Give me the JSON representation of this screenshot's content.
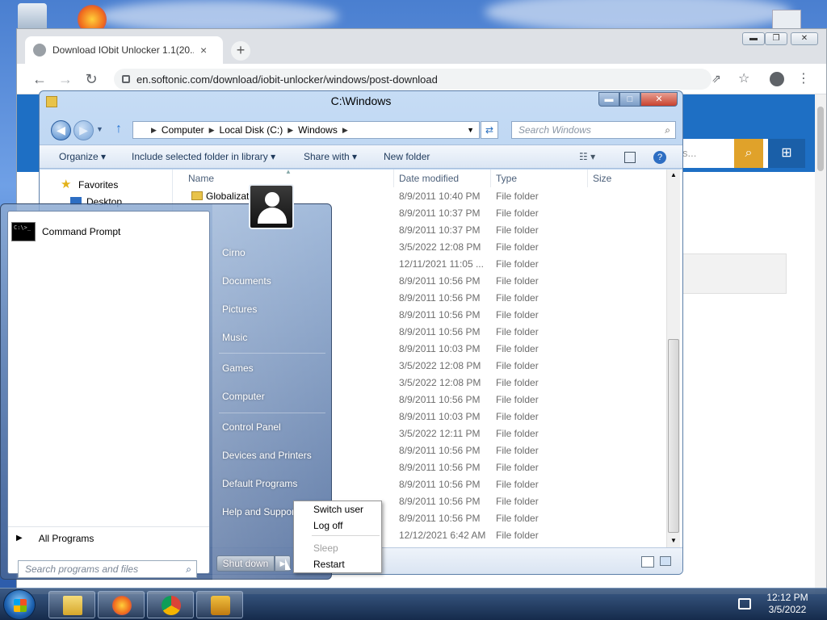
{
  "chrome": {
    "tab_title": "Download IObit Unlocker 1.1(20...",
    "tab_close": "×",
    "new_tab": "+",
    "url": "en.softonic.com/download/iobit-unlocker/windows/post-download",
    "back": "←",
    "forward": "→",
    "reload": "↻",
    "share": "⇗",
    "bookmark": "☆",
    "menu": "⋮",
    "minimize": "▬",
    "restore": "❐",
    "close": "✕",
    "site_search_text": "s...",
    "site_search_icon": "⌕",
    "site_windows_icon": "⊞"
  },
  "explorer": {
    "title": "C:\\Windows",
    "minimize": "▬",
    "maximize": "□",
    "close": "✕",
    "breadcrumb": [
      "Computer",
      "Local Disk (C:)",
      "Windows"
    ],
    "search_placeholder": "Search Windows",
    "toolbar": {
      "organize": "Organize ▾",
      "include": "Include selected folder in library ▾",
      "share": "Share with ▾",
      "new_folder": "New folder"
    },
    "nav_pane": {
      "favorites": "Favorites",
      "desktop": "Desktop"
    },
    "columns": {
      "name": "Name",
      "date": "Date modified",
      "type": "Type",
      "size": "Size"
    },
    "first_row_name": "Globalizati",
    "rows": [
      {
        "date": "8/9/2011 10:40 PM",
        "type": "File folder"
      },
      {
        "date": "8/9/2011 10:37 PM",
        "type": "File folder"
      },
      {
        "date": "8/9/2011 10:37 PM",
        "type": "File folder"
      },
      {
        "date": "3/5/2022 12:08 PM",
        "type": "File folder"
      },
      {
        "date": "12/11/2021 11:05 ...",
        "type": "File folder"
      },
      {
        "date": "8/9/2011 10:56 PM",
        "type": "File folder"
      },
      {
        "date": "8/9/2011 10:56 PM",
        "type": "File folder"
      },
      {
        "date": "8/9/2011 10:56 PM",
        "type": "File folder"
      },
      {
        "date": "8/9/2011 10:56 PM",
        "type": "File folder"
      },
      {
        "date": "8/9/2011 10:03 PM",
        "type": "File folder"
      },
      {
        "date": "3/5/2022 12:08 PM",
        "type": "File folder"
      },
      {
        "date": "3/5/2022 12:08 PM",
        "type": "File folder"
      },
      {
        "date": "8/9/2011 10:56 PM",
        "type": "File folder"
      },
      {
        "date": "8/9/2011 10:03 PM",
        "type": "File folder"
      },
      {
        "date": "3/5/2022 12:11 PM",
        "type": "File folder"
      },
      {
        "date": "8/9/2011 10:56 PM",
        "type": "File folder"
      },
      {
        "date": "8/9/2011 10:56 PM",
        "type": "File folder"
      },
      {
        "date": "8/9/2011 10:56 PM",
        "type": "File folder"
      },
      {
        "date": "8/9/2011 10:56 PM",
        "type": "File folder"
      },
      {
        "date": "8/9/2011 10:56 PM",
        "type": "File folder"
      },
      {
        "date": "12/12/2021 6:42 AM",
        "type": "File folder"
      }
    ]
  },
  "start_menu": {
    "pinned": "Command Prompt",
    "cmd_icon_text": "C:\\>_",
    "all_programs": "All Programs",
    "search_placeholder": "Search programs and files",
    "right_links": {
      "user": "Cirno",
      "documents": "Documents",
      "pictures": "Pictures",
      "music": "Music",
      "games": "Games",
      "computer": "Computer",
      "control_panel": "Control Panel",
      "devices": "Devices and Printers",
      "default_programs": "Default Programs",
      "help": "Help and Support"
    },
    "shutdown": "Shut down",
    "shutdown_arrow": "▶"
  },
  "power_menu": {
    "switch_user": "Switch user",
    "log_off": "Log off",
    "sleep": "Sleep",
    "restart": "Restart"
  },
  "taskbar": {
    "time": "12:12 PM",
    "date": "3/5/2022"
  }
}
